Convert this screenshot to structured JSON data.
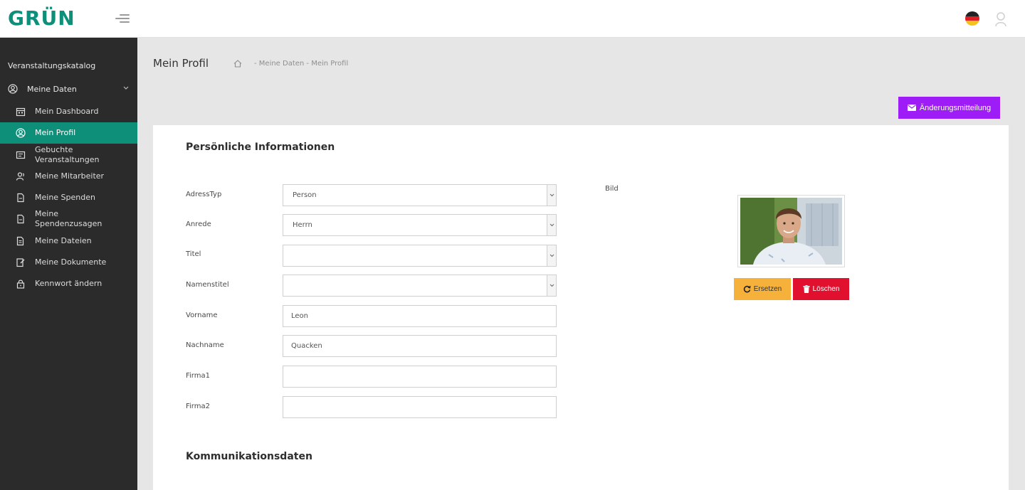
{
  "header": {
    "logo": "GRÜN",
    "menu_icon": "hamburger-icon",
    "language_icon": "german-flag-icon",
    "user_icon": "user-icon"
  },
  "sidebar": {
    "catalog_label": "Veranstaltungskatalog",
    "group": {
      "label": "Meine Daten",
      "icon": "user-circle-icon"
    },
    "items": [
      {
        "label": "Mein Dashboard",
        "icon": "calendar-icon"
      },
      {
        "label": "Mein Profil",
        "icon": "user-circle-icon",
        "active": true
      },
      {
        "label": "Gebuchte Veranstaltungen",
        "icon": "ticket-icon"
      },
      {
        "label": "Meine Mitarbeiter",
        "icon": "users-icon"
      },
      {
        "label": "Meine Spenden",
        "icon": "document-icon"
      },
      {
        "label": "Meine Spendenzusagen",
        "icon": "document-icon"
      },
      {
        "label": "Meine Dateien",
        "icon": "files-icon"
      },
      {
        "label": "Meine Dokumente",
        "icon": "edit-document-icon"
      },
      {
        "label": "Kennwort ändern",
        "icon": "lock-icon"
      }
    ],
    "colors": {
      "background": "#2b2b2b",
      "active": "#0e8f7a"
    }
  },
  "page": {
    "title": "Mein Profil",
    "breadcrumb": "- Meine Daten - Mein Profil",
    "change_button": "Änderungsmitteilung"
  },
  "personal": {
    "section_title": "Persönliche Informationen",
    "fields": [
      {
        "label": "AdressTyp",
        "value": "Person",
        "type": "select"
      },
      {
        "label": "Anrede",
        "value": "Herrn",
        "type": "select"
      },
      {
        "label": "Titel",
        "value": "",
        "type": "select"
      },
      {
        "label": "Namenstitel",
        "value": "",
        "type": "select"
      },
      {
        "label": "Vorname",
        "value": "Leon",
        "type": "input"
      },
      {
        "label": "Nachname",
        "value": "Quacken",
        "type": "input"
      },
      {
        "label": "Firma1",
        "value": "",
        "type": "input"
      },
      {
        "label": "Firma2",
        "value": "",
        "type": "input"
      }
    ],
    "image_label": "Bild",
    "replace_button": "Ersetzen",
    "delete_button": "Löschen"
  },
  "communication": {
    "section_title": "Kommunikationsdaten"
  },
  "colors": {
    "brand": "#0e8f7a",
    "purple": "#9e1cf5",
    "orange": "#f6b13b",
    "red": "#e2102f"
  }
}
